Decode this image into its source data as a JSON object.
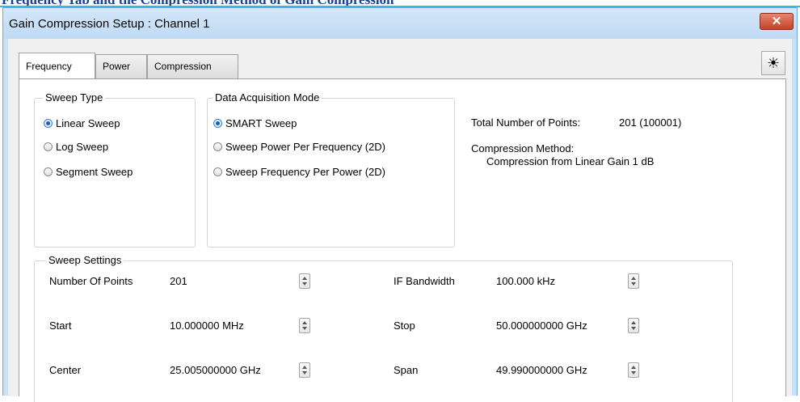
{
  "header_fragment": "Frequency Tab and the Compression Method of Gain Compression",
  "window": {
    "title": "Gain Compression Setup : Channel 1",
    "close_glyph": "✕"
  },
  "tabs": [
    {
      "label": "Frequency",
      "active": true
    },
    {
      "label": "Power",
      "active": false
    },
    {
      "label": "Compression",
      "active": false
    }
  ],
  "settings_icon": "☀",
  "sweep_type": {
    "label": "Sweep Type",
    "options": [
      {
        "label": "Linear Sweep",
        "checked": true
      },
      {
        "label": "Log Sweep",
        "checked": false
      },
      {
        "label": "Segment Sweep",
        "checked": false
      }
    ]
  },
  "acquisition": {
    "label": "Data Acquisition Mode",
    "options": [
      {
        "label": "SMART Sweep",
        "checked": true
      },
      {
        "label": "Sweep Power Per Frequency (2D)",
        "checked": false
      },
      {
        "label": "Sweep Frequency Per Power (2D)",
        "checked": false
      }
    ]
  },
  "info": {
    "total_points_label": "Total Number of Points:",
    "total_points_value": "201 (100001)",
    "method_label": "Compression Method:",
    "method_value": "Compression from Linear Gain 1 dB"
  },
  "sweep_settings": {
    "label": "Sweep Settings",
    "fields": {
      "number_of_points": {
        "label": "Number Of Points",
        "value": "201"
      },
      "if_bandwidth": {
        "label": "IF Bandwidth",
        "value": "100.000 kHz"
      },
      "start": {
        "label": "Start",
        "value": "10.000000 MHz"
      },
      "stop": {
        "label": "Stop",
        "value": "50.000000000 GHz"
      },
      "center": {
        "label": "Center",
        "value": "25.005000000 GHz"
      },
      "span": {
        "label": "Span",
        "value": "49.990000000 GHz"
      }
    }
  },
  "colors": {
    "window_frame": "#c9e1f6",
    "close_button": "#c7402a",
    "radio_checked": "#1d5bb8"
  }
}
